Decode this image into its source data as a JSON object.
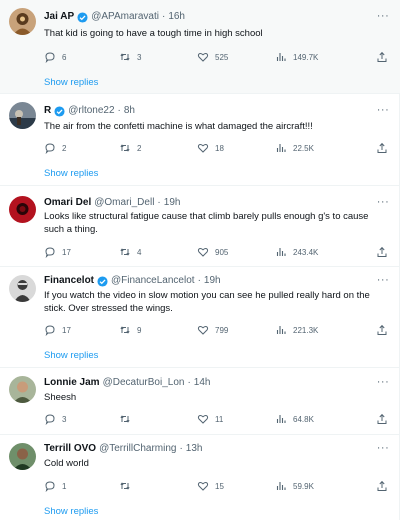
{
  "replies": [
    {
      "name": "Jai AP",
      "handle": "@APAmaravati",
      "dot": "·",
      "time": "16h",
      "verified": true,
      "text": "That kid is going to have a tough time in high school",
      "comments": "6",
      "retweets": "3",
      "likes": "525",
      "views": "149.7K",
      "show_replies": "Show replies",
      "avatar_colors": [
        "#c8a27a",
        "#5a3b1e"
      ]
    },
    {
      "name": "R",
      "handle": "@rltone22",
      "dot": "·",
      "time": "8h",
      "verified": true,
      "text": "The air from the confetti machine is what damaged the aircraft!!!",
      "comments": "2",
      "retweets": "2",
      "likes": "18",
      "views": "22.5K",
      "show_replies": "Show replies",
      "avatar_colors": [
        "#7a8794",
        "#2c3a48"
      ]
    },
    {
      "name": "Omari Del",
      "handle": "@Omari_Dell",
      "dot": "·",
      "time": "19h",
      "verified": false,
      "text": "Looks like structural fatigue cause that climb barely pulls enough g's to cause such a thing.",
      "comments": "17",
      "retweets": "4",
      "likes": "905",
      "views": "243.4K",
      "show_replies": "",
      "avatar_colors": [
        "#b3121f",
        "#2a0508"
      ]
    },
    {
      "name": "Financelot",
      "handle": "@FinanceLancelot",
      "dot": "·",
      "time": "19h",
      "verified": true,
      "text": "If you watch the video in slow motion you can see he pulled really hard on the stick. Over stressed the wings.",
      "comments": "17",
      "retweets": "9",
      "likes": "799",
      "views": "221.3K",
      "show_replies": "Show replies",
      "avatar_colors": [
        "#d9d9d9",
        "#3a3a3a"
      ]
    },
    {
      "name": "Lonnie Jam",
      "handle": "@DecaturBoi_Lon",
      "dot": "·",
      "time": "14h",
      "verified": false,
      "text": "Sheesh",
      "comments": "3",
      "retweets": "",
      "likes": "11",
      "views": "64.8K",
      "show_replies": "",
      "avatar_colors": [
        "#a8b59a",
        "#4d5a3f"
      ]
    },
    {
      "name": "Terrill OVO",
      "handle": "@TerrillCharming",
      "dot": "·",
      "time": "13h",
      "verified": false,
      "text": "Cold world",
      "comments": "1",
      "retweets": "",
      "likes": "15",
      "views": "59.9K",
      "show_replies": "Show replies",
      "avatar_colors": [
        "#6f8f6a",
        "#203a22"
      ]
    }
  ],
  "colors": {
    "accent": "#1d9bf0",
    "muted": "#536471",
    "text": "#0f1419",
    "highlight_bg": "#f7f9f9",
    "divider": "#eff3f4"
  }
}
